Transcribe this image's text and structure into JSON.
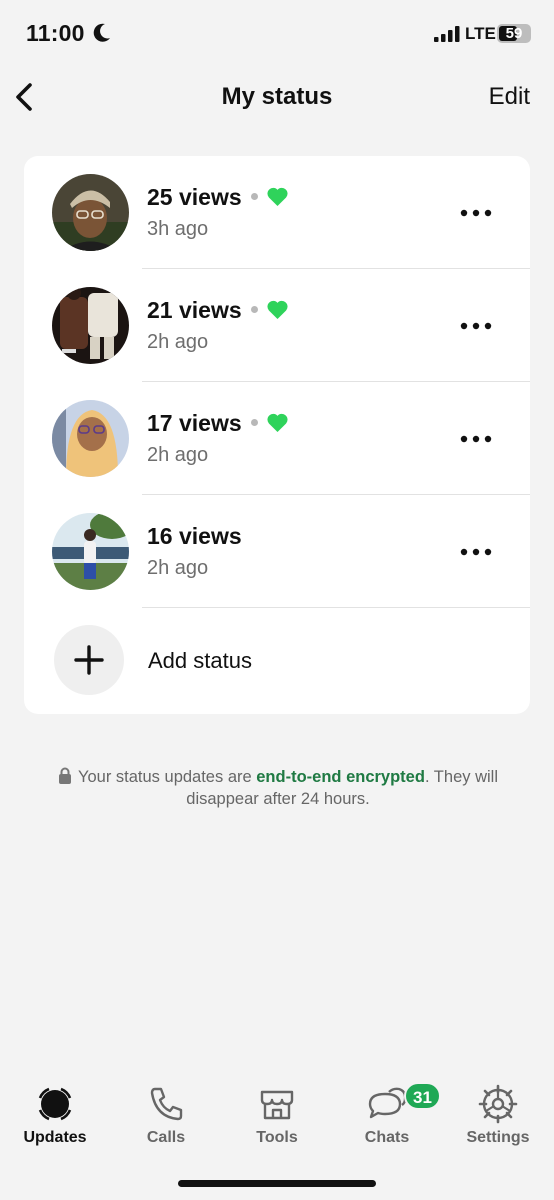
{
  "status_bar": {
    "time": "11:00",
    "network": "LTE",
    "battery_level": "59",
    "icons": [
      "moon-icon",
      "signal-icon",
      "battery-icon"
    ]
  },
  "header": {
    "title": "My status",
    "edit_label": "Edit",
    "back_icon": "chevron-left-icon"
  },
  "statuses": [
    {
      "views": "25 views",
      "time": "3h ago",
      "liked": true
    },
    {
      "views": "21 views",
      "time": "2h ago",
      "liked": true
    },
    {
      "views": "17 views",
      "time": "2h ago",
      "liked": true
    },
    {
      "views": "16 views",
      "time": "2h ago",
      "liked": false
    }
  ],
  "add_status": {
    "label": "Add status",
    "icon": "plus-icon"
  },
  "encryption": {
    "prefix": "Your status updates are ",
    "highlight": "end-to-end encrypted",
    "suffix": ". They will disappear after 24 hours.",
    "icon": "lock-icon"
  },
  "tabs": [
    {
      "label": "Updates",
      "icon": "updates-icon",
      "active": true
    },
    {
      "label": "Calls",
      "icon": "phone-icon",
      "active": false
    },
    {
      "label": "Tools",
      "icon": "storefront-icon",
      "active": false
    },
    {
      "label": "Chats",
      "icon": "chat-bubbles-icon",
      "active": false,
      "badge": "31"
    },
    {
      "label": "Settings",
      "icon": "gear-icon",
      "active": false
    }
  ],
  "colors": {
    "accent_green": "#1fa855",
    "heart_green": "#2fd35b",
    "encrypted_text": "#1f7a43",
    "background": "#f3f3f3"
  }
}
